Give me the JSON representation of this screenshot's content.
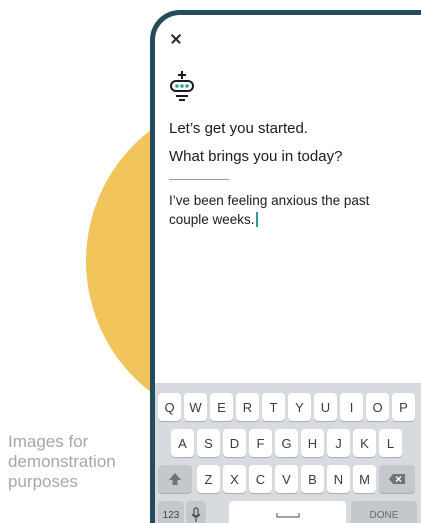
{
  "caption": {
    "line1": "Images for",
    "line2": "demonstration",
    "line3": "purposes"
  },
  "chat": {
    "greeting": "Let’s get you started.",
    "question": "What brings you in today?",
    "user_message": "I’ve been feeling anxious the past couple weeks."
  },
  "keyboard": {
    "row1": [
      "Q",
      "W",
      "E",
      "R",
      "T",
      "Y",
      "U",
      "I",
      "O",
      "P"
    ],
    "row2": [
      "A",
      "S",
      "D",
      "F",
      "G",
      "H",
      "J",
      "K",
      "L"
    ],
    "row3": [
      "Z",
      "X",
      "C",
      "V",
      "B",
      "N",
      "M"
    ],
    "numbers_label": "123",
    "done_label": "DONE"
  },
  "colors": {
    "phone_frame": "#244c5a",
    "accent_circle": "#f1c55c",
    "bot_eyes": "#2aa69a",
    "cursor": "#2c9c9c"
  }
}
